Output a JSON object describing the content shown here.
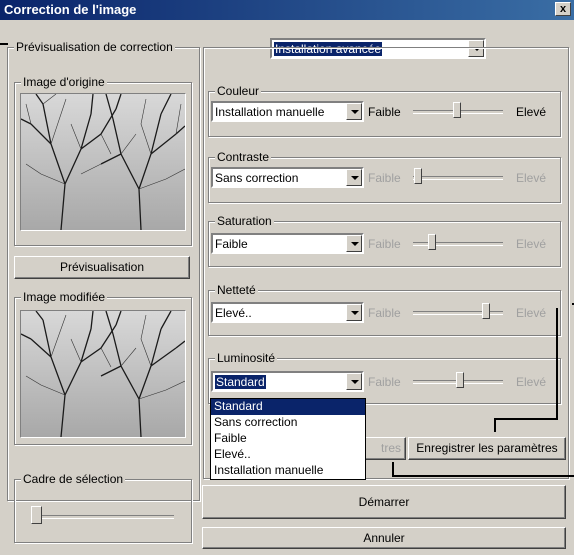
{
  "window": {
    "title": "Correction de l'image",
    "close_label": "x"
  },
  "preview_group": {
    "legend": "Prévisualisation de correction",
    "mode_select": "Installation avancée"
  },
  "original_image": {
    "legend": "Image d'origine"
  },
  "preview_button": "Prévisualisation",
  "modified_image": {
    "legend": "Image modifiée"
  },
  "selection_frame": {
    "legend": "Cadre de sélection",
    "slider_position": 0.05
  },
  "low_label": "Faible",
  "high_label": "Elevé",
  "color": {
    "legend": "Couleur",
    "value": "Installation manuelle",
    "enabled": true,
    "slider": 0.54
  },
  "contrast": {
    "legend": "Contraste",
    "value": "Sans correction",
    "enabled": false,
    "slider": 0.0
  },
  "saturation": {
    "legend": "Saturation",
    "value": "Faible",
    "enabled": false,
    "slider": 0.18
  },
  "sharpness": {
    "legend": "Netteté",
    "value": "Elevé..",
    "enabled": false,
    "slider": 0.82
  },
  "brightness": {
    "legend": "Luminosité",
    "value": "Standard",
    "enabled": false,
    "slider": 0.5
  },
  "brightness_options": [
    "Standard",
    "Sans correction",
    "Faible",
    "Elevé..",
    "Installation manuelle"
  ],
  "brightness_options_selected": 0,
  "partial_button_text": "tres",
  "save_settings_button": "Enregistrer les paramètres",
  "start_button": "Démarrer",
  "cancel_button": "Annuler"
}
